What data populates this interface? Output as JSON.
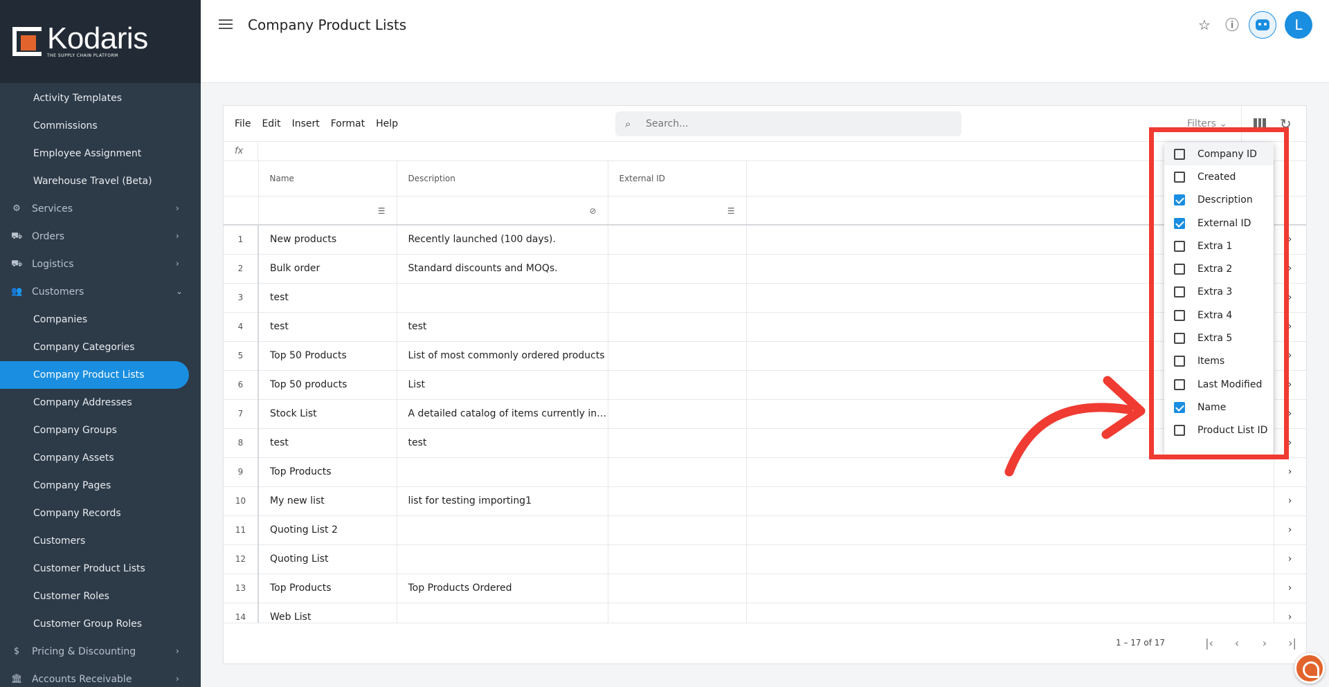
{
  "brand": {
    "name": "Kodaris",
    "tagline": "THE SUPPLY CHAIN PLATFORM"
  },
  "sidebar": {
    "items": [
      {
        "label": "Activity Templates",
        "kind": "sub"
      },
      {
        "label": "Commissions",
        "kind": "sub"
      },
      {
        "label": "Employee Assignment",
        "kind": "sub"
      },
      {
        "label": "Warehouse Travel (Beta)",
        "kind": "sub"
      },
      {
        "label": "Services",
        "kind": "group",
        "icon": "gears-icon",
        "chevron": "chevron-right-icon"
      },
      {
        "label": "Orders",
        "kind": "group",
        "icon": "truck-icon",
        "chevron": "chevron-right-icon"
      },
      {
        "label": "Logistics",
        "kind": "group",
        "icon": "delivery-icon",
        "chevron": "chevron-right-icon"
      },
      {
        "label": "Customers",
        "kind": "group",
        "icon": "people-icon",
        "chevron": "chevron-down-icon"
      },
      {
        "label": "Companies",
        "kind": "sub"
      },
      {
        "label": "Company Categories",
        "kind": "sub"
      },
      {
        "label": "Company Product Lists",
        "kind": "sub",
        "active": true
      },
      {
        "label": "Company Addresses",
        "kind": "sub"
      },
      {
        "label": "Company Groups",
        "kind": "sub"
      },
      {
        "label": "Company Assets",
        "kind": "sub"
      },
      {
        "label": "Company Pages",
        "kind": "sub"
      },
      {
        "label": "Company Records",
        "kind": "sub"
      },
      {
        "label": "Customers",
        "kind": "sub"
      },
      {
        "label": "Customer Product Lists",
        "kind": "sub"
      },
      {
        "label": "Customer Roles",
        "kind": "sub"
      },
      {
        "label": "Customer Group Roles",
        "kind": "sub"
      },
      {
        "label": "Pricing & Discounting",
        "kind": "group",
        "icon": "dollar-icon",
        "chevron": "chevron-right-icon"
      },
      {
        "label": "Accounts Receivable",
        "kind": "group",
        "icon": "bank-icon",
        "chevron": "chevron-right-icon"
      }
    ]
  },
  "header": {
    "title": "Company Product Lists",
    "avatar_letter": "L"
  },
  "toolbar": {
    "menus": [
      "File",
      "Edit",
      "Insert",
      "Format",
      "Help"
    ],
    "search_placeholder": "Search...",
    "filters_label": "Filters"
  },
  "formula_bar": {
    "label": "fx"
  },
  "grid": {
    "columns": [
      "Name",
      "Description",
      "External ID"
    ],
    "rows": [
      {
        "n": "1",
        "name": "New products",
        "desc": "Recently launched (100 days).",
        "ext": ""
      },
      {
        "n": "2",
        "name": "Bulk order",
        "desc": "Standard discounts and MOQs.",
        "ext": ""
      },
      {
        "n": "3",
        "name": "test",
        "desc": "",
        "ext": ""
      },
      {
        "n": "4",
        "name": "test",
        "desc": "test",
        "ext": ""
      },
      {
        "n": "5",
        "name": "Top 50 Products",
        "desc": "List of most commonly ordered products",
        "ext": ""
      },
      {
        "n": "6",
        "name": "Top 50 products",
        "desc": "List",
        "ext": ""
      },
      {
        "n": "7",
        "name": "Stock List",
        "desc": "A detailed catalog of items currently in st...",
        "ext": ""
      },
      {
        "n": "8",
        "name": "test",
        "desc": "test",
        "ext": ""
      },
      {
        "n": "9",
        "name": "Top Products",
        "desc": "",
        "ext": ""
      },
      {
        "n": "10",
        "name": "My new list",
        "desc": "list for testing importing1",
        "ext": ""
      },
      {
        "n": "11",
        "name": "Quoting List 2",
        "desc": "",
        "ext": ""
      },
      {
        "n": "12",
        "name": "Quoting List",
        "desc": "",
        "ext": ""
      },
      {
        "n": "13",
        "name": "Top Products",
        "desc": "Top Products Ordered",
        "ext": ""
      },
      {
        "n": "14",
        "name": "Web List",
        "desc": "",
        "ext": ""
      }
    ]
  },
  "pager": {
    "range": "1 – 17 of 17"
  },
  "column_chooser": {
    "options": [
      {
        "label": "Company ID",
        "checked": false
      },
      {
        "label": "Created",
        "checked": false
      },
      {
        "label": "Description",
        "checked": true
      },
      {
        "label": "External ID",
        "checked": true
      },
      {
        "label": "Extra 1",
        "checked": false
      },
      {
        "label": "Extra 2",
        "checked": false
      },
      {
        "label": "Extra 3",
        "checked": false
      },
      {
        "label": "Extra 4",
        "checked": false
      },
      {
        "label": "Extra 5",
        "checked": false
      },
      {
        "label": "Items",
        "checked": false
      },
      {
        "label": "Last Modified",
        "checked": false
      },
      {
        "label": "Name",
        "checked": true
      },
      {
        "label": "Product List ID",
        "checked": false
      }
    ]
  },
  "colors": {
    "accent": "#1a8ee0",
    "sidebar": "#2d3a48",
    "annotation": "#ef3b32",
    "brand_orange": "#e2642c"
  }
}
